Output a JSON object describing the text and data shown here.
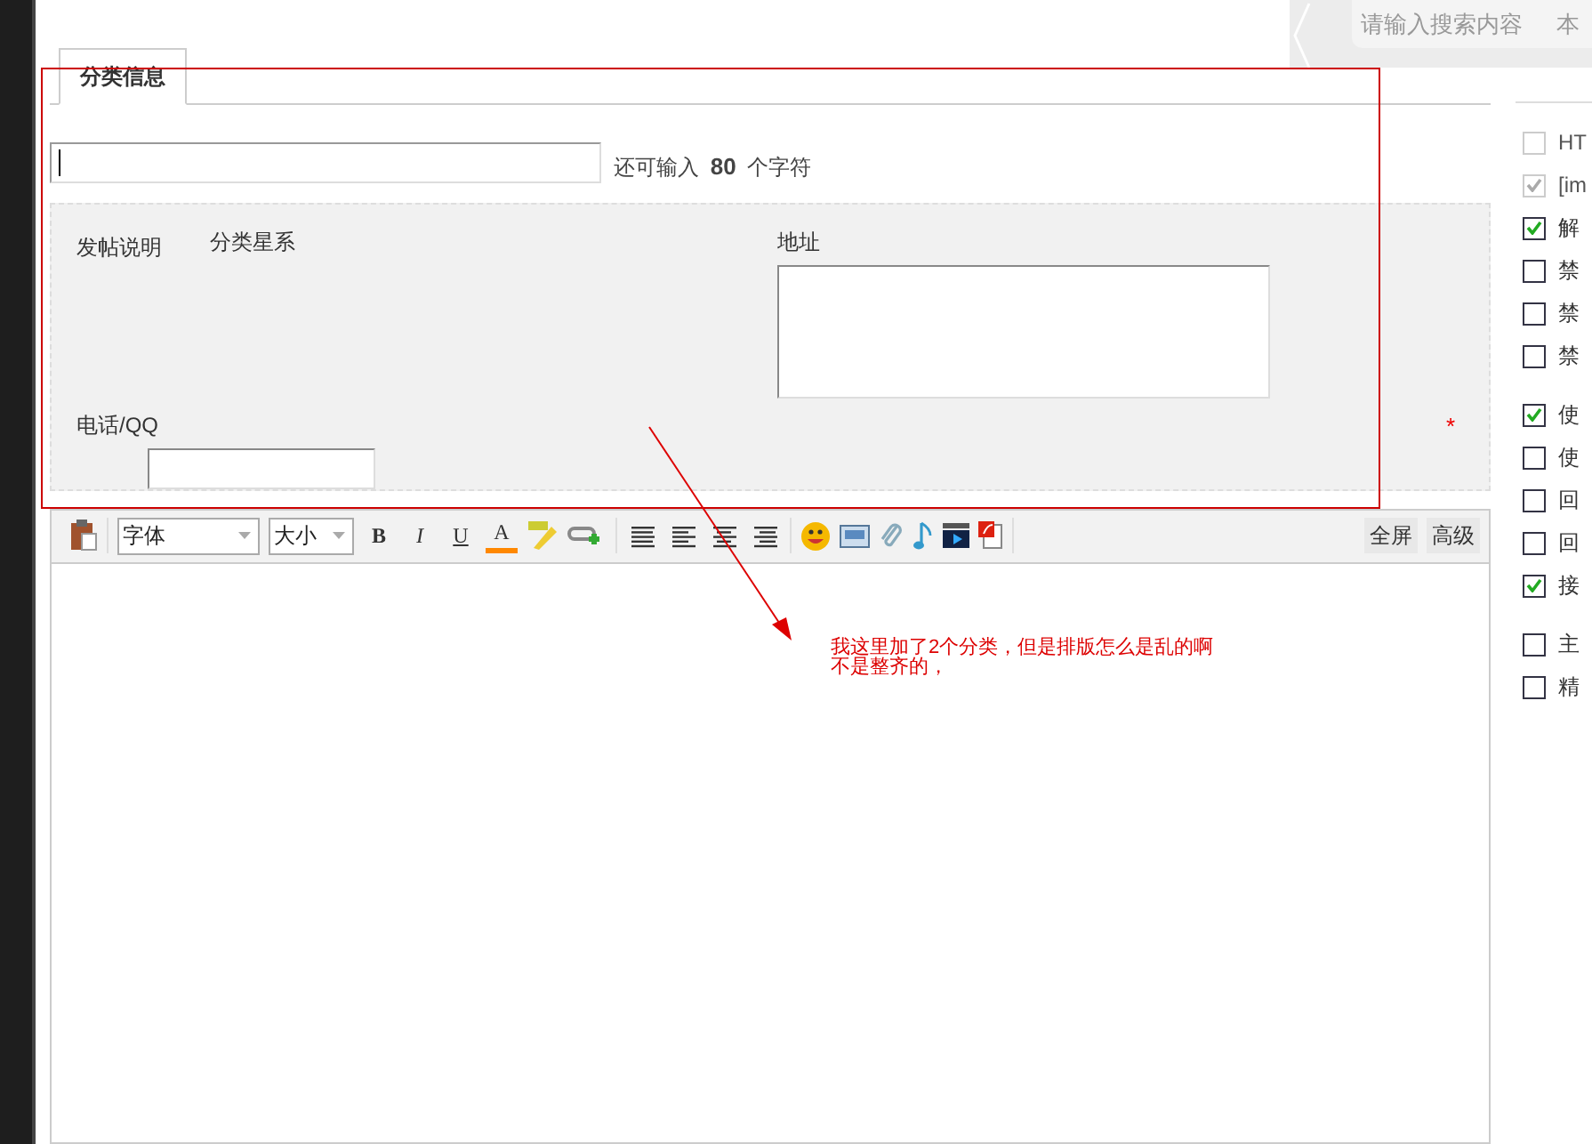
{
  "tab": {
    "label": "分类信息",
    "selected": true
  },
  "title_field": {
    "remaining_prefix": "还可输入",
    "remaining_count": "80",
    "remaining_suffix": "个字符"
  },
  "fields": [
    {
      "kind": "text",
      "label": "发帖说明",
      "value": "分类星系"
    },
    {
      "kind": "textarea",
      "label": "地址"
    },
    {
      "kind": "input",
      "label": "电话/QQ",
      "required_mark": "*"
    }
  ],
  "editor": {
    "selects": [
      "字体",
      "大小"
    ],
    "format_buttons": [
      "B",
      "I",
      "U",
      "A"
    ],
    "mode_buttons": [
      "全屏",
      "高级"
    ]
  },
  "search": {
    "placeholder": "请输入搜索内容",
    "scope": "本"
  },
  "option_groups": [
    {
      "options": [
        {
          "label": "HT",
          "checked": false,
          "disabled": true
        },
        {
          "label": "[im",
          "checked": true,
          "disabled": true
        },
        {
          "label": "解",
          "checked": true,
          "disabled": false
        },
        {
          "label": "禁",
          "checked": false,
          "disabled": false
        },
        {
          "label": "禁",
          "checked": false,
          "disabled": false
        },
        {
          "label": "禁",
          "checked": false,
          "disabled": false
        }
      ]
    },
    {
      "options": [
        {
          "label": "使",
          "checked": true,
          "disabled": false
        },
        {
          "label": "使",
          "checked": false,
          "disabled": false
        },
        {
          "label": "回",
          "checked": false,
          "disabled": false
        },
        {
          "label": "回",
          "checked": false,
          "disabled": false
        },
        {
          "label": "接",
          "checked": true,
          "disabled": false
        }
      ]
    },
    {
      "options": [
        {
          "label": "主",
          "checked": false,
          "disabled": false
        },
        {
          "label": "精",
          "checked": false,
          "disabled": false
        }
      ]
    }
  ],
  "annotation": {
    "lines": [
      "我这里加了2个分类，但是排版怎么是乱的啊",
      "不是整齐的，"
    ]
  }
}
